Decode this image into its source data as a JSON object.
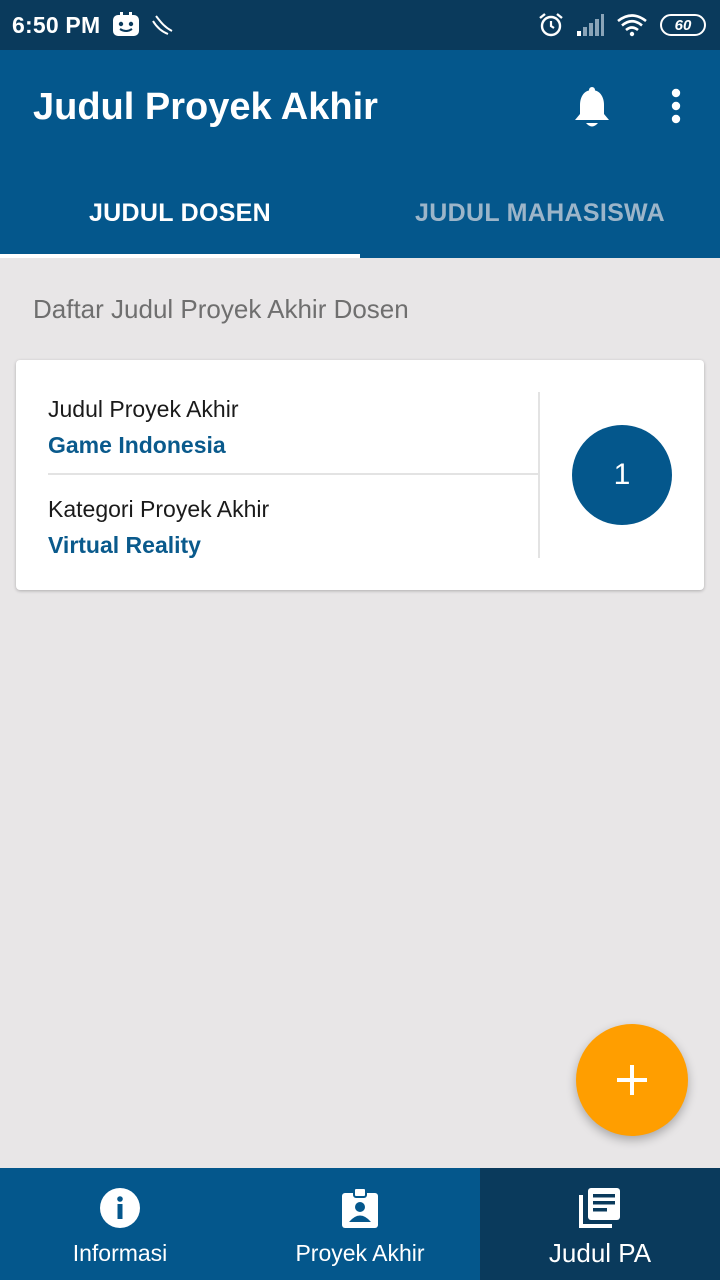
{
  "status_bar": {
    "time": "6:50 PM",
    "battery": "60",
    "icons": [
      "app-notification-icon",
      "moon-icon",
      "alarm-icon",
      "signal-icon",
      "wifi-icon",
      "battery-icon"
    ]
  },
  "app_bar": {
    "title": "Judul Proyek Akhir",
    "actions": [
      "bell-icon",
      "more-vert-icon"
    ]
  },
  "tabs": [
    {
      "label": "JUDUL DOSEN",
      "active": true
    },
    {
      "label": "JUDUL MAHASISWA",
      "active": false
    }
  ],
  "content": {
    "section_title": "Daftar Judul Proyek Akhir Dosen",
    "cards": [
      {
        "title_label": "Judul Proyek Akhir",
        "title_value": "Game Indonesia",
        "category_label": "Kategori Proyek Akhir",
        "category_value": "Virtual Reality",
        "count": "1"
      }
    ]
  },
  "fab": {
    "icon": "plus-icon"
  },
  "bottom_nav": [
    {
      "label": "Informasi",
      "icon": "info-icon",
      "active": false
    },
    {
      "label": "Proyek Akhir",
      "icon": "id-badge-icon",
      "active": false
    },
    {
      "label": "Judul PA",
      "icon": "library-books-icon",
      "active": true
    }
  ],
  "colors": {
    "status_bar": "#0a3a5c",
    "primary": "#04578c",
    "background": "#e8e6e7",
    "accent": "#ff9e00",
    "value_text": "#0a5a8c"
  }
}
